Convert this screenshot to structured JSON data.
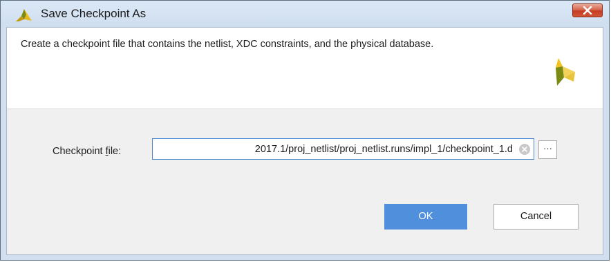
{
  "window": {
    "title": "Save Checkpoint As",
    "icon": "vivado-logo-icon",
    "close_icon": "close-icon"
  },
  "header": {
    "description": "Create a checkpoint file that contains the netlist, XDC constraints, and the physical database.",
    "logo_icon": "vivado-logo-icon"
  },
  "form": {
    "checkpoint_label_before": "Checkpoint ",
    "checkpoint_label_mnemonic": "f",
    "checkpoint_label_after": "ile:",
    "checkpoint_value": "2017.1/proj_netlist/proj_netlist.runs/impl_1/checkpoint_1.d",
    "clear_icon": "clear-icon",
    "browse_label": "···"
  },
  "buttons": {
    "ok_label": "OK",
    "cancel_label": "Cancel"
  },
  "colors": {
    "accent": "#4f8fdb",
    "logo_light": "#f4c21b",
    "logo_dark": "#7a8a12",
    "close_button": "#c43c21"
  }
}
